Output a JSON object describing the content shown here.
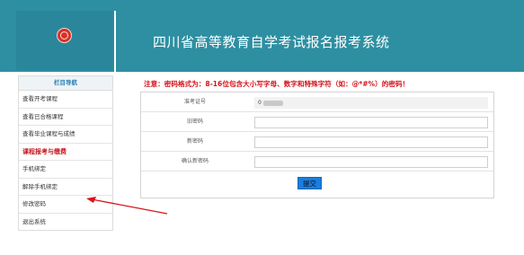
{
  "header": {
    "title": "四川省高等教育自学考试报名报考系统",
    "logo": "university-emblem-icon"
  },
  "sidebar": {
    "title": "栏目导航",
    "items": [
      {
        "label": "查看开考课程"
      },
      {
        "label": "查看已合格课程"
      },
      {
        "label": "查看毕业课程与成绩"
      },
      {
        "label": "课程报考与缴费"
      },
      {
        "label": "手机绑定"
      },
      {
        "label": "解除手机绑定"
      },
      {
        "label": "修改密码"
      },
      {
        "label": "退出系统"
      }
    ]
  },
  "notice": "注意：密码格式为：8-16位包含大小写字母、数字和特殊字符（如：@*#%）的密码！",
  "form": {
    "exam_id_label": "准考证号",
    "exam_id_value": "0",
    "old_password_label": "旧密码",
    "new_password_label": "新密码",
    "confirm_password_label": "确认新密码",
    "submit_label": "提交"
  },
  "colors": {
    "header_bg": "#2e8fa2",
    "notice": "#d4141b",
    "section_item": "#c4141b",
    "submit_bg": "#1b7de0",
    "arrow": "#d4141b"
  }
}
